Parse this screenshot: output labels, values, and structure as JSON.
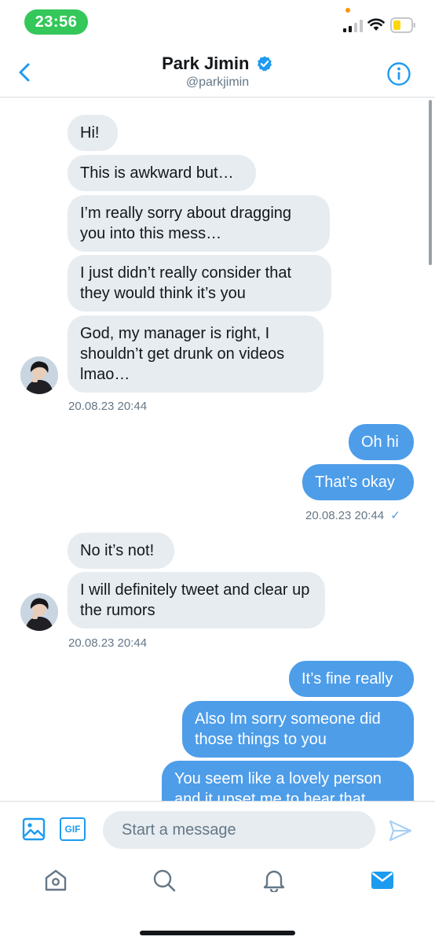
{
  "status_bar": {
    "time": "23:56"
  },
  "header": {
    "name": "Park Jimin",
    "handle": "@parkjimin"
  },
  "messages": {
    "group1": {
      "m1": "Hi!",
      "m2": "This is awkward but…",
      "m3": "I’m really sorry about dragging you into this mess…",
      "m4": "I just didn’t really consider that they would think it’s you",
      "m5": "God, my manager is right, I shouldn’t get drunk on videos lmao…",
      "timestamp": "20.08.23 20:44"
    },
    "group2": {
      "m1": "Oh hi",
      "m2": "That’s okay",
      "timestamp": "20.08.23 20:44",
      "read_mark": "✓"
    },
    "group3": {
      "m1": "No it’s not!",
      "m2": "I will definitely tweet and clear up the rumors",
      "timestamp": "20.08.23 20:44"
    },
    "group4": {
      "m1": "It’s fine really",
      "m2": "Also Im sorry someone did those things to you",
      "m3": "You seem like a lovely person and it upset me to hear that"
    }
  },
  "composer": {
    "placeholder": "Start a message",
    "gif_label": "GIF"
  },
  "tabs": [
    {
      "name": "home",
      "active": false
    },
    {
      "name": "search",
      "active": false
    },
    {
      "name": "notifications",
      "active": false
    },
    {
      "name": "messages",
      "active": true
    }
  ],
  "colors": {
    "accent": "#4d9de9",
    "received_bubble": "#e6ecf0",
    "muted_text": "#657786",
    "time_pill": "#34c759"
  }
}
